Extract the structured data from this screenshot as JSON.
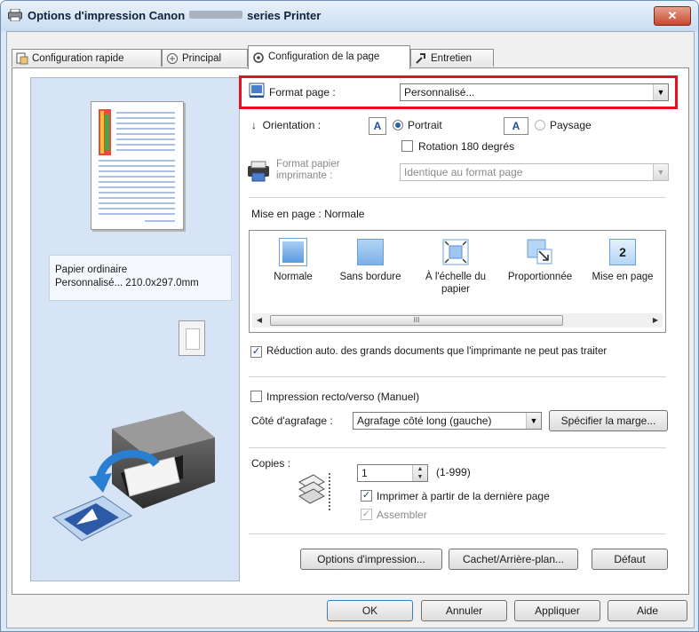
{
  "window": {
    "title_prefix": "Options d'impression Canon",
    "title_suffix": "series Printer",
    "close_label": "✕"
  },
  "tabs": [
    {
      "label": "Configuration rapide"
    },
    {
      "label": "Principal"
    },
    {
      "label": "Configuration de la page"
    },
    {
      "label": "Entretien"
    }
  ],
  "preview": {
    "media_type": "Papier ordinaire",
    "paper_summary": "Personnalisé... 210.0x297.0mm"
  },
  "page_setup": {
    "page_size_label": "Format page :",
    "page_size_value": "Personnalisé...",
    "orientation_label": "Orientation :",
    "portrait_label": "Portrait",
    "landscape_label": "Paysage",
    "orientation_selected": "Portrait",
    "rotate_180_label": "Rotation 180 degrés",
    "rotate_180_checked": false,
    "printer_paper_label_1": "Format papier",
    "printer_paper_label_2": "imprimante :",
    "printer_paper_value": "Identique au format page",
    "layout_label": "Mise en page :",
    "layout_value": "Normale",
    "layouts": [
      {
        "label": "Normale",
        "icon": "normal-layout-icon"
      },
      {
        "label": "Sans bordure",
        "icon": "borderless-layout-icon"
      },
      {
        "label": "À l'échelle du papier",
        "icon": "fit-to-page-layout-icon"
      },
      {
        "label": "Proportionnée",
        "icon": "scaled-layout-icon"
      },
      {
        "label": "Mise en page",
        "icon": "page-layout-icon"
      }
    ],
    "layout_icon_number": "2",
    "scroll_thumb_glyph": "III",
    "auto_reduce_label": "Réduction auto. des grands documents que l'imprimante ne peut pas traiter",
    "auto_reduce_checked": true,
    "duplex_label": "Impression recto/verso (Manuel)",
    "duplex_checked": false,
    "stapling_label": "Côté d'agrafage :",
    "stapling_value": "Agrafage côté long (gauche)",
    "specify_margin_label": "Spécifier la marge...",
    "copies_label": "Copies :",
    "copies_value": "1",
    "copies_range": "(1-999)",
    "print_from_last_label": "Imprimer à partir de la dernière page",
    "print_from_last_checked": true,
    "collate_label": "Assembler",
    "collate_checked": true,
    "print_options_label": "Options d'impression...",
    "stamp_background_label": "Cachet/Arrière-plan...",
    "defaults_label": "Défaut"
  },
  "footer": {
    "ok_label": "OK",
    "cancel_label": "Annuler",
    "apply_label": "Appliquer",
    "help_label": "Aide"
  },
  "colors": {
    "highlight": "#e8111f",
    "window_frame": "#6d8fb5",
    "preview_background": "#d7e4f5"
  }
}
